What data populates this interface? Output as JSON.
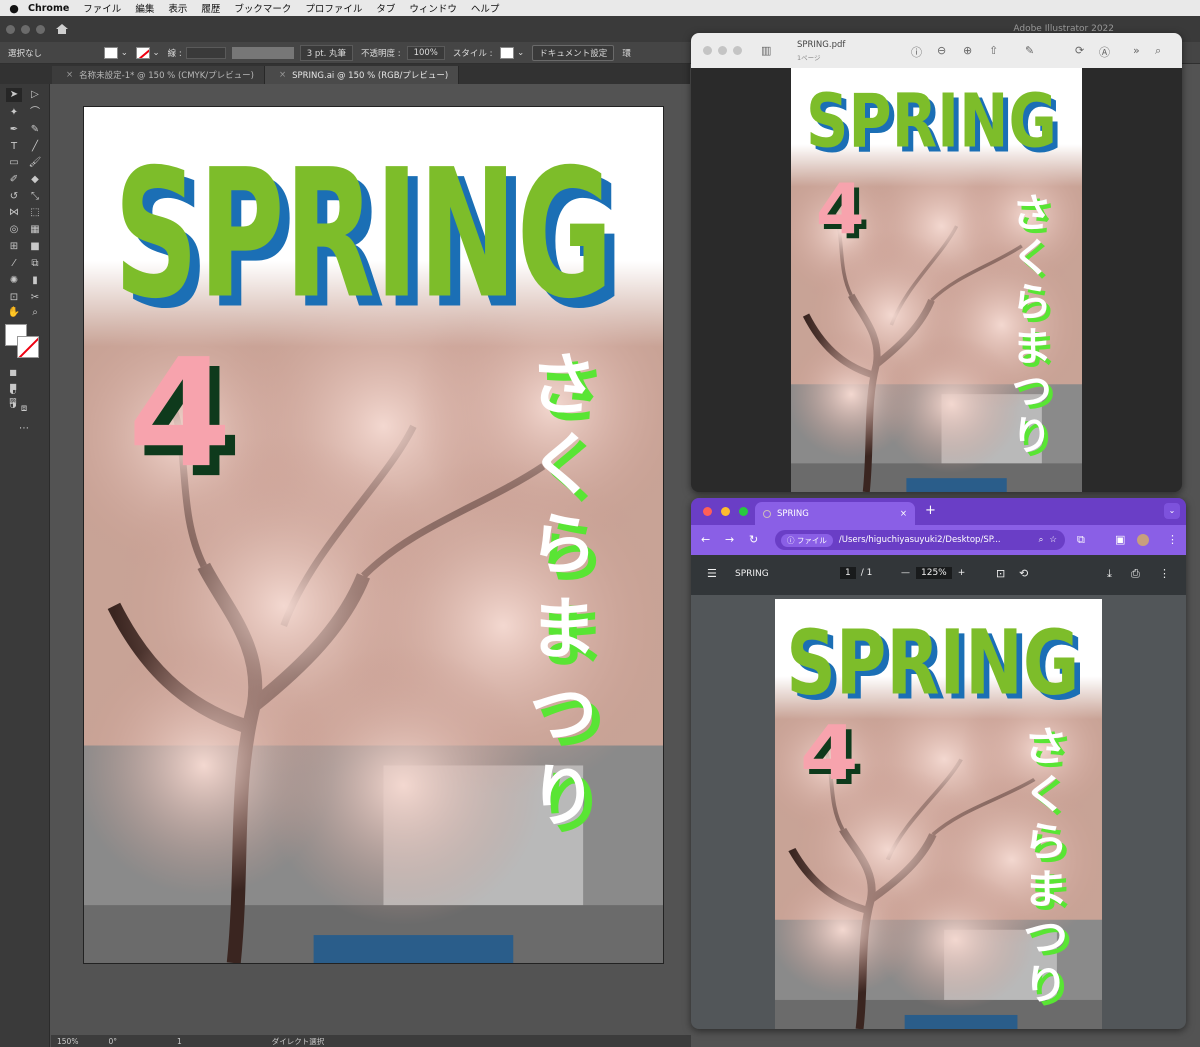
{
  "mac_menu": {
    "apple": "",
    "app": "Chrome",
    "items": [
      "ファイル",
      "編集",
      "表示",
      "履歴",
      "ブックマーク",
      "プロファイル",
      "タブ",
      "ウィンドウ",
      "ヘルプ"
    ]
  },
  "illustrator": {
    "app_title": "Adobe Illustrator 2022",
    "control": {
      "selection": "選択なし",
      "stroke_label": "線 :",
      "brush": "3 pt. 丸筆",
      "opacity_label": "不透明度 :",
      "opacity": "100%",
      "style_label": "スタイル :",
      "doc_settings": "ドキュメント設定",
      "env": "環"
    },
    "tabs": [
      {
        "label": "名称未設定-1* @ 150 % (CMYK/プレビュー)",
        "close": "×"
      },
      {
        "label": "SPRING.ai @ 150 % (RGB/プレビュー)",
        "close": "×"
      }
    ],
    "status": {
      "zoom": "150%",
      "rotation": "0°",
      "artboard": "1",
      "tool": "ダイレクト選択"
    }
  },
  "preview": {
    "filename": "SPRING.pdf",
    "pages": "1ページ"
  },
  "chrome": {
    "tab_title": "SPRING",
    "tab_close": "×",
    "new_tab": "+",
    "site_chip": "ファイル",
    "url": "/Users/higuchiyasuyuki2/Desktop/SP...",
    "pdf": {
      "title": "SPRING",
      "page_current": "1",
      "page_sep": "/",
      "page_total": "1",
      "zoom": "125%",
      "minus": "—",
      "plus": "+"
    }
  },
  "poster": {
    "headline": "SPRING",
    "number": "4",
    "vertical_text": [
      "さ",
      "く",
      "ら",
      "ま",
      "つ",
      "り"
    ],
    "colors": {
      "headline": "#7dbd2a",
      "headline_shadow": "#1b6fb5",
      "number": "#f7a3ad",
      "number_shadow": "#0e3a1c",
      "vertical": "#ffffff",
      "vertical_shadow": "#59e534"
    }
  }
}
